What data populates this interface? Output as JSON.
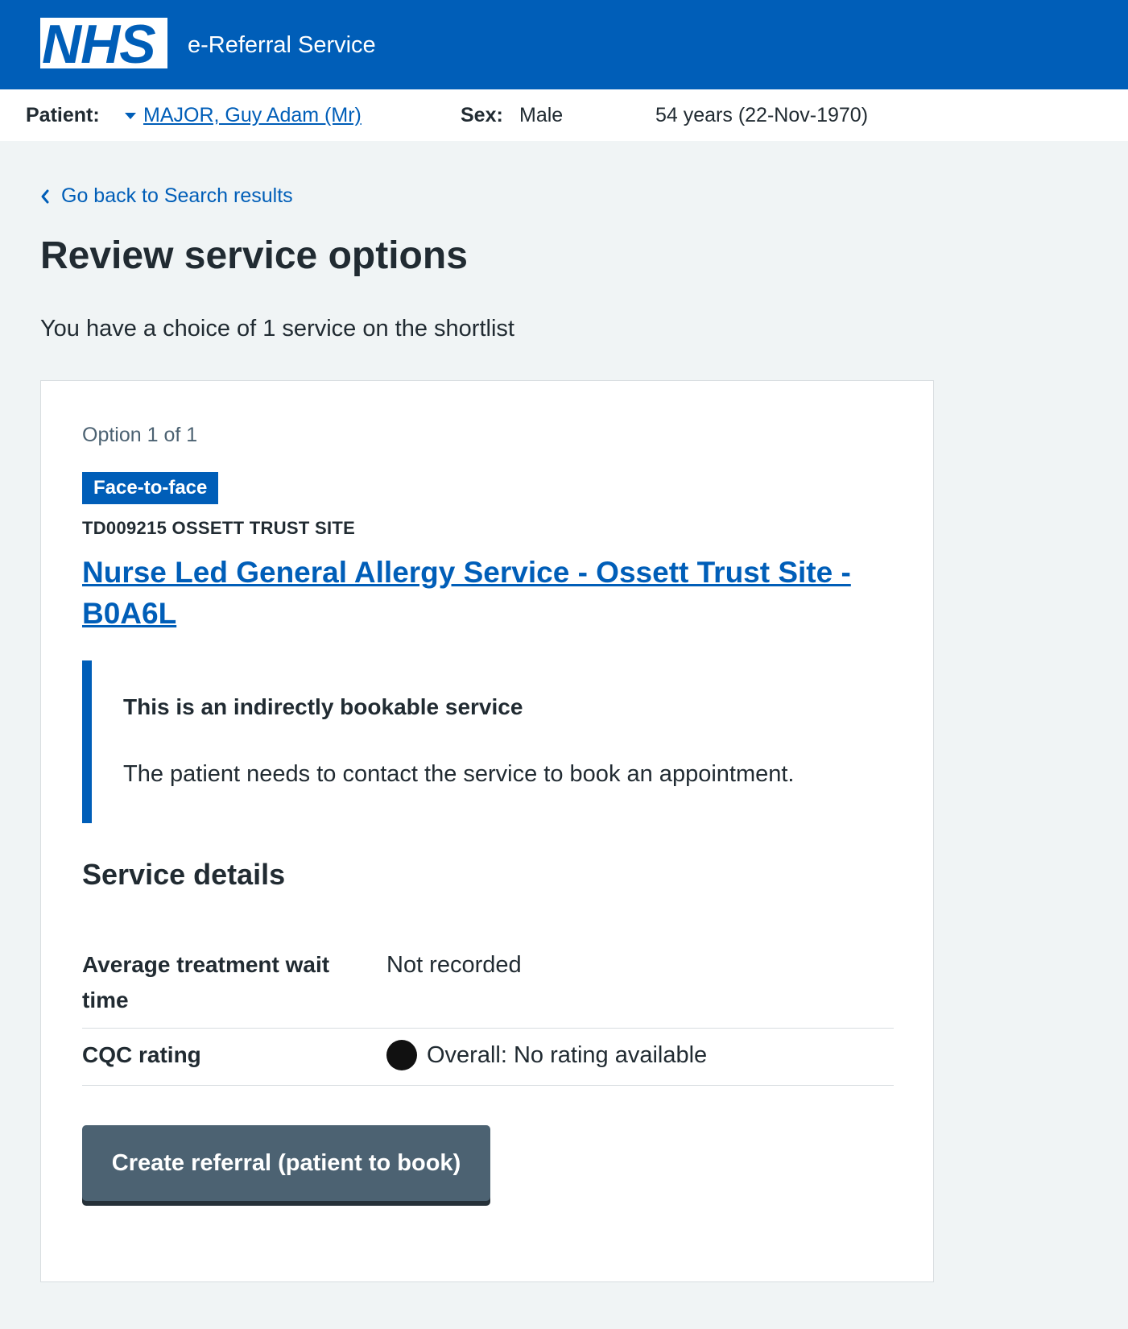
{
  "header": {
    "logo_text": "NHS",
    "service_name": "e-Referral Service",
    "brand_color": "#005eb8"
  },
  "patient_bar": {
    "patient_label": "Patient:",
    "patient_name": "MAJOR, Guy Adam (Mr)",
    "sex_label": "Sex:",
    "sex_value": "Male",
    "age_dob": "54 years (22-Nov-1970)"
  },
  "navigation": {
    "back_link": "Go back to Search results"
  },
  "page": {
    "title": "Review service options",
    "choice_text": "You have a choice of 1 service on the shortlist"
  },
  "option": {
    "label": "Option 1 of 1",
    "tag": "Face-to-face",
    "site_code": "TD009215 OSSETT TRUST SITE",
    "service_name": "Nurse Led General Allergy Service - Ossett Trust Site - B0A6L",
    "inset_title": "This is an indirectly bookable service",
    "inset_body": "The patient needs to contact the service to book an appointment.",
    "details_heading": "Service details",
    "details": [
      {
        "key": "Average treatment wait time",
        "value": "Not recorded"
      },
      {
        "key": "CQC rating",
        "value": "Overall: No rating available",
        "icon": "rating-dot-icon"
      }
    ],
    "action_button": "Create referral (patient to book)"
  }
}
